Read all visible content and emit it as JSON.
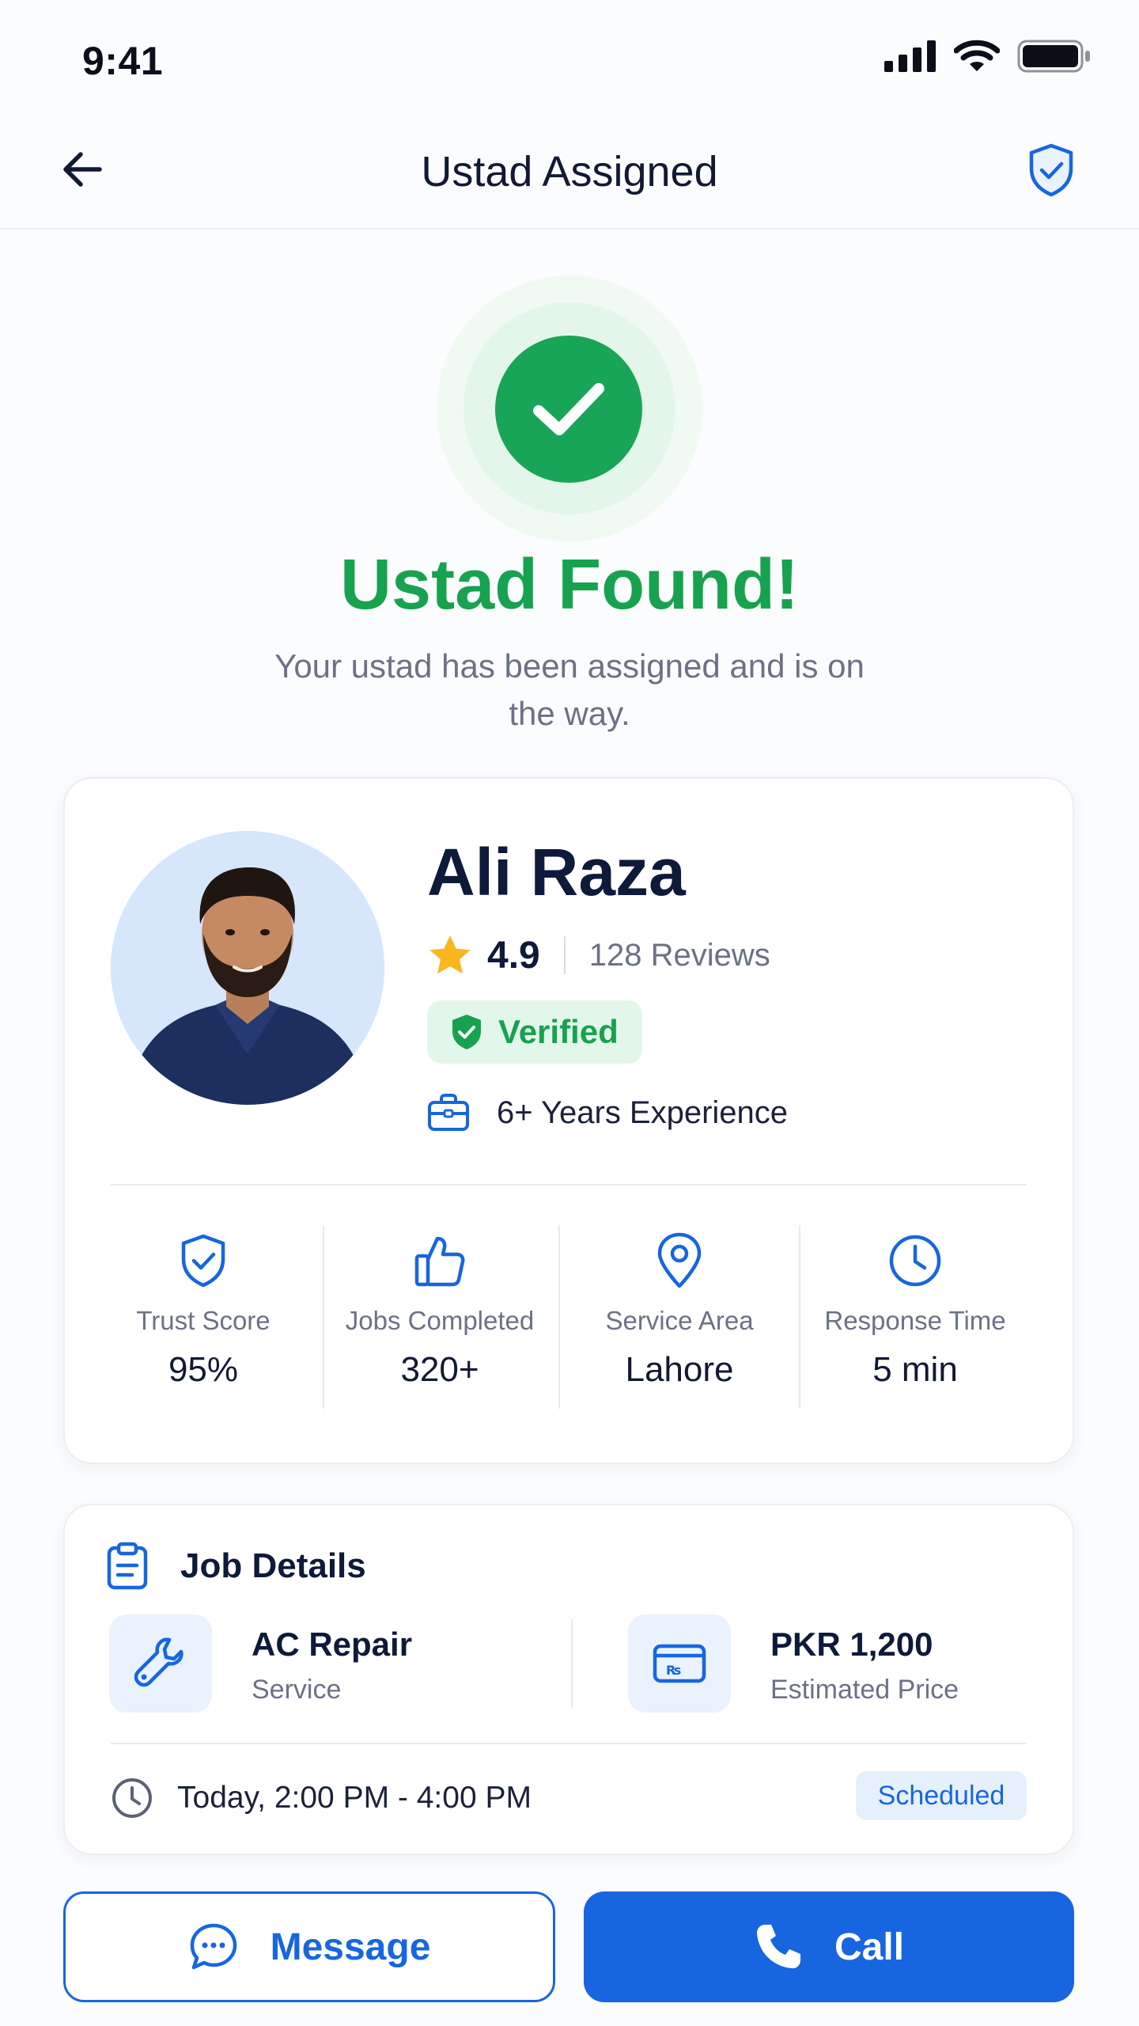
{
  "status_bar": {
    "time": "9:41"
  },
  "header": {
    "title": "Ustad Assigned"
  },
  "success": {
    "title": "Ustad Found!",
    "subtitle": "Your ustad has been assigned and is on the way."
  },
  "profile": {
    "name": "Ali Raza",
    "rating": "4.9",
    "reviews": "128 Reviews",
    "verified_label": "Verified",
    "experience": "6+ Years Experience"
  },
  "stats": [
    {
      "label": "Trust Score",
      "value": "95%",
      "icon": "shield-check-icon"
    },
    {
      "label": "Jobs Completed",
      "value": "320+",
      "icon": "thumbs-up-icon"
    },
    {
      "label": "Service Area",
      "value": "Lahore",
      "icon": "location-pin-icon"
    },
    {
      "label": "Response Time",
      "value": "5 min",
      "icon": "clock-icon"
    }
  ],
  "job": {
    "title": "Job Details",
    "service_value": "AC Repair",
    "service_label": "Service",
    "price_value": "PKR 1,200",
    "price_label": "Estimated Price",
    "schedule": "Today, 2:00 PM - 4:00 PM",
    "status": "Scheduled"
  },
  "actions": {
    "message_label": "Message",
    "call_label": "Call"
  },
  "colors": {
    "primary": "#1766e0",
    "success": "#17a24f",
    "star": "#f8b720"
  }
}
